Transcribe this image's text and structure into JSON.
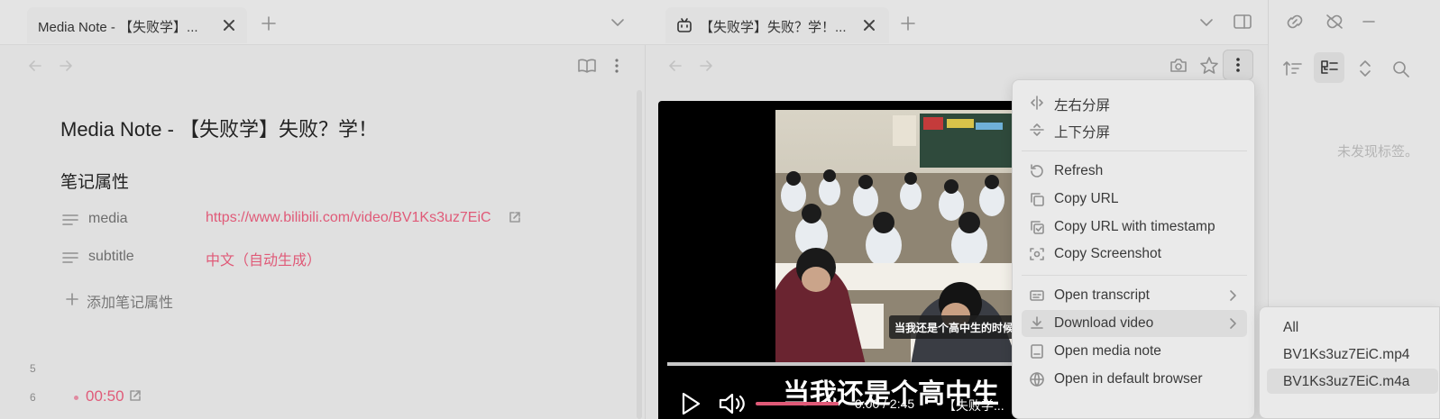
{
  "left_tab": {
    "title": "Media Note - 【失败学】..."
  },
  "note": {
    "title": "Media Note - 【失败学】失败？学！",
    "properties_heading": "笔记属性",
    "properties": [
      {
        "key": "media",
        "value": "https://www.bilibili.com/video/BV1Ks3uz7EiC"
      },
      {
        "key": "subtitle",
        "value": "中文（自动生成）"
      }
    ],
    "add_property": "添加笔记属性",
    "line_numbers": [
      "5",
      "6"
    ],
    "timestamp_link": "00:50"
  },
  "right_tab": {
    "title": "【失败学】失败？学！..."
  },
  "video": {
    "overlay_caption": "当我还是个高中生的时候",
    "subtitle": "当我还是个高中生",
    "time": "0:00 / 2:45",
    "channel_text": "【失败学..."
  },
  "sidebar": {
    "empty_text": "未发现标签。"
  },
  "menu": {
    "items": [
      {
        "label": "左右分屏",
        "icon": "split-horizontal-icon"
      },
      {
        "label": "上下分屏",
        "icon": "split-vertical-icon"
      },
      {
        "label": "Refresh",
        "icon": "refresh-icon"
      },
      {
        "label": "Copy URL",
        "icon": "copy-icon"
      },
      {
        "label": "Copy URL with timestamp",
        "icon": "copy-check-icon"
      },
      {
        "label": "Copy Screenshot",
        "icon": "screenshot-icon"
      },
      {
        "label": "Open transcript",
        "icon": "transcript-icon"
      },
      {
        "label": "Download video",
        "icon": "download-icon"
      },
      {
        "label": "Open media note",
        "icon": "note-icon"
      },
      {
        "label": "Open in default browser",
        "icon": "globe-icon"
      }
    ]
  },
  "submenu": {
    "items": [
      "All",
      "BV1Ks3uz7EiC.mp4",
      "BV1Ks3uz7EiC.m4a"
    ]
  },
  "colors": {
    "link": "#e05a78",
    "menu_hover": "#dcdcdc",
    "background": "#e0e0e0"
  }
}
